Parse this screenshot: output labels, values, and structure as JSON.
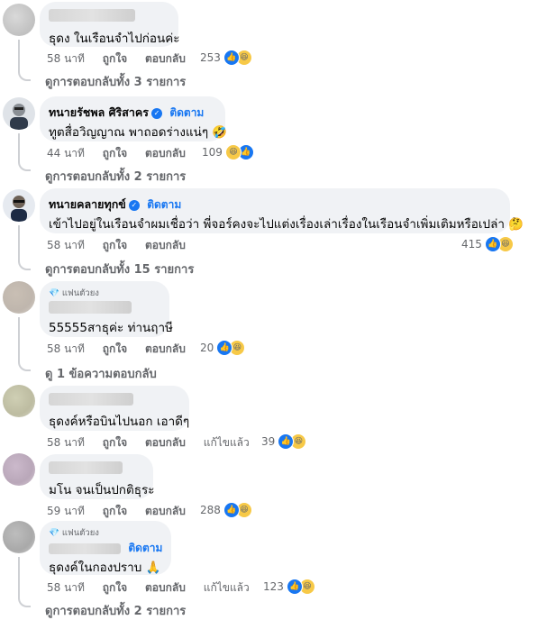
{
  "follow_label": "ติดตาม",
  "top_fan_label": "แฟนตัวยง",
  "meta": {
    "like": "ถูกใจ",
    "reply": "ตอบกลับ",
    "edited": "แก้ไขแล้ว"
  },
  "comments": [
    {
      "text": "ธุดง ในเรือนจำไปก่อนค่ะ",
      "time": "58 นาที",
      "count": "253",
      "replies": "ดูการตอบกลับทั้ง 3 รายการ"
    },
    {
      "name": "ทนายรัชพล ศิริสาคร",
      "text": "ทูตสื่อวิญญาณ พาถอดร่างแน่ๆ 🤣",
      "time": "44 นาที",
      "count": "109",
      "replies": "ดูการตอบกลับทั้ง 2 รายการ"
    },
    {
      "name": "ทนายคลายทุกข์",
      "text": "เข้าไปอยู่ในเรือนจำผมเชื่อว่า พี่จอร์คงจะไปแต่งเรื่องเล่าเรื่องในเรือนจำเพิ่มเติมหรือเปล่า 🤔",
      "time": "58 นาที",
      "count": "415",
      "replies": "ดูการตอบกลับทั้ง 15 รายการ"
    },
    {
      "text": "55555สาธุค่ะ ท่านฤาษี",
      "time": "58 นาที",
      "count": "20",
      "replies": "ดู 1 ข้อความตอบกลับ"
    },
    {
      "text": "ธุดงค์หรือบินไปนอก เอาดีๆ",
      "time": "58 นาที",
      "count": "39"
    },
    {
      "text": "มโน จนเป็นปกติธุระ",
      "time": "59 นาที",
      "count": "288"
    },
    {
      "text": "ธุดงค์ในกองปราบ 🙏",
      "time": "58 นาที",
      "count": "123",
      "replies": "ดูการตอบกลับทั้ง 2 รายการ"
    }
  ]
}
